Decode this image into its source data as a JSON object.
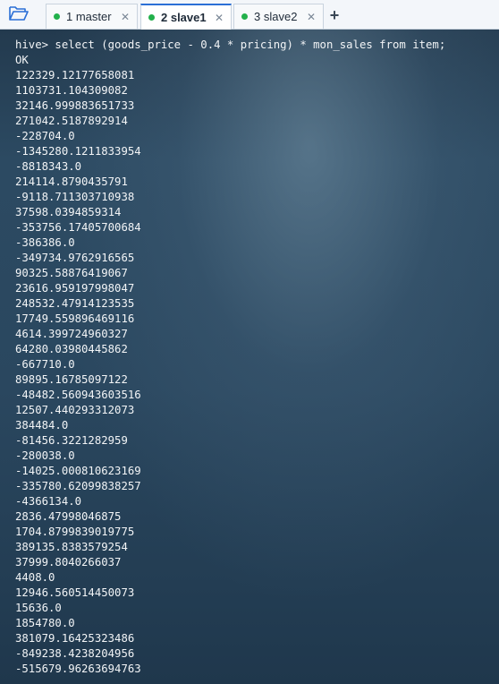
{
  "tabs": [
    {
      "label": "1 master",
      "status_color": "#22b04b",
      "active": false
    },
    {
      "label": "2 slave1",
      "status_color": "#22b04b",
      "active": true
    },
    {
      "label": "3 slave2",
      "status_color": "#22b04b",
      "active": false
    }
  ],
  "icons": {
    "open_folder": "folder-open-icon",
    "close_tab": "close-icon",
    "new_tab": "plus-icon"
  },
  "glyphs": {
    "close": "✕",
    "plus": "+"
  },
  "colors": {
    "accent": "#2b6fd6",
    "terminal_text": "#f2f4f6",
    "status_connected": "#22b04b"
  },
  "terminal": {
    "lines": [
      "hive> select (goods_price - 0.4 * pricing) * mon_sales from item;",
      "OK",
      "122329.12177658081",
      "1103731.104309082",
      "32146.999883651733",
      "271042.5187892914",
      "-228704.0",
      "-1345280.1211833954",
      "-8818343.0",
      "214114.8790435791",
      "-9118.711303710938",
      "37598.0394859314",
      "-353756.17405700684",
      "-386386.0",
      "-349734.9762916565",
      "90325.58876419067",
      "23616.959197998047",
      "248532.47914123535",
      "17749.559896469116",
      "4614.399724960327",
      "64280.03980445862",
      "-667710.0",
      "89895.16785097122",
      "-48482.560943603516",
      "12507.440293312073",
      "384484.0",
      "-81456.3221282959",
      "-280038.0",
      "-14025.000810623169",
      "-335780.62099838257",
      "-4366134.0",
      "2836.47998046875",
      "1704.8799839019775",
      "389135.8383579254",
      "37999.8040266037",
      "4408.0",
      "12946.560514450073",
      "15636.0",
      "1854780.0",
      "381079.16425323486",
      "-849238.4238204956",
      "-515679.96263694763"
    ]
  }
}
